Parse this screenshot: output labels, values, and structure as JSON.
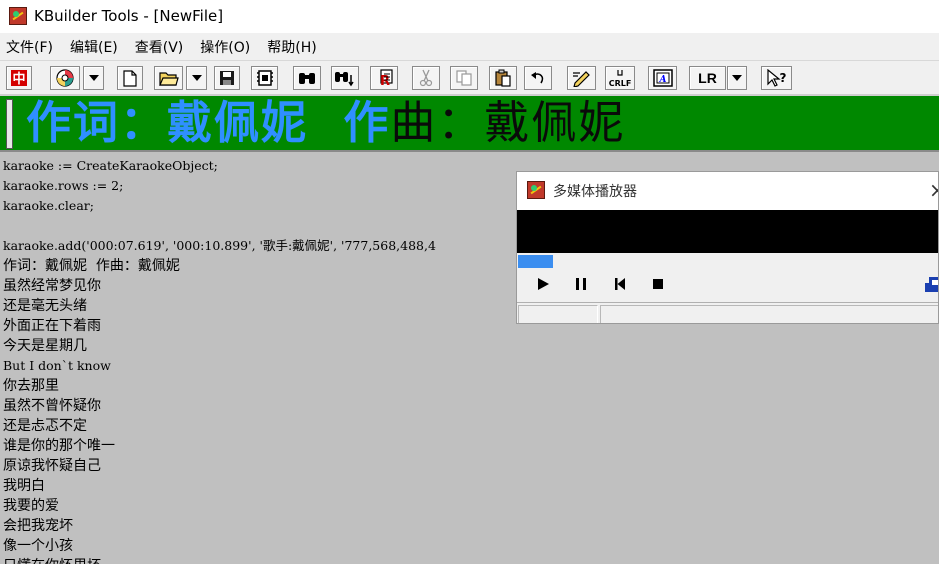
{
  "window": {
    "title": "KBuilder Tools - [NewFile]",
    "icon": "app-icon"
  },
  "menu": [
    "文件(F)",
    "编辑(E)",
    "查看(V)",
    "操作(O)",
    "帮助(H)"
  ],
  "toolbar": {
    "buttons": [
      {
        "name": "chinese-mode-icon",
        "label": "中"
      },
      {
        "name": "color-wheel-icon",
        "label": ""
      },
      {
        "name": "new-file-icon",
        "label": ""
      },
      {
        "name": "open-folder-icon",
        "label": ""
      },
      {
        "name": "save-icon",
        "label": ""
      },
      {
        "name": "film-icon",
        "label": ""
      },
      {
        "name": "find-icon",
        "label": ""
      },
      {
        "name": "find-next-icon",
        "label": ""
      },
      {
        "name": "replace-icon",
        "label": ""
      },
      {
        "name": "cut-icon",
        "label": ""
      },
      {
        "name": "copy-icon",
        "label": ""
      },
      {
        "name": "paste-icon",
        "label": ""
      },
      {
        "name": "undo-icon",
        "label": ""
      },
      {
        "name": "pen-icon",
        "label": ""
      },
      {
        "name": "crlf-icon",
        "label": "CRLF"
      },
      {
        "name": "text-box-icon",
        "label": ""
      },
      {
        "name": "lr-mode-icon",
        "label": "LR"
      },
      {
        "name": "help-cursor-icon",
        "label": ""
      }
    ]
  },
  "banner": {
    "part1": "作词：戴佩妮  作",
    "part2": "曲：戴佩妮",
    "colors": {
      "background": "#008800",
      "text": "#2f8fff",
      "highlight": "#0a0a0a"
    }
  },
  "editor": {
    "lines": [
      "karaoke := CreateKaraokeObject;",
      "karaoke.rows := 2;",
      "karaoke.clear;",
      "",
      "karaoke.add('000:07.619', '000:10.899', '歌手:戴佩妮', '777,568,488,4",
      "作词：戴佩妮  作曲：戴佩妮",
      "虽然经常梦见你",
      "还是毫无头绪",
      "外面正在下着雨",
      "今天是星期几",
      "But I don`t know",
      "你去那里",
      "虽然不曾怀疑你",
      "还是忐忑不定",
      "谁是你的那个唯一",
      "原谅我怀疑自己",
      "我明白",
      "我要的爱",
      "会把我宠坏",
      "像一个小孩",
      "只懂在你怀里坏"
    ]
  },
  "player": {
    "title": "多媒体播放器",
    "close_label": "×",
    "progress": 0.082,
    "controls": [
      "play-icon",
      "pause-icon",
      "previous-icon",
      "stop-icon"
    ],
    "colors": {
      "progress": "#3b8ef0",
      "video": "#000000"
    }
  }
}
